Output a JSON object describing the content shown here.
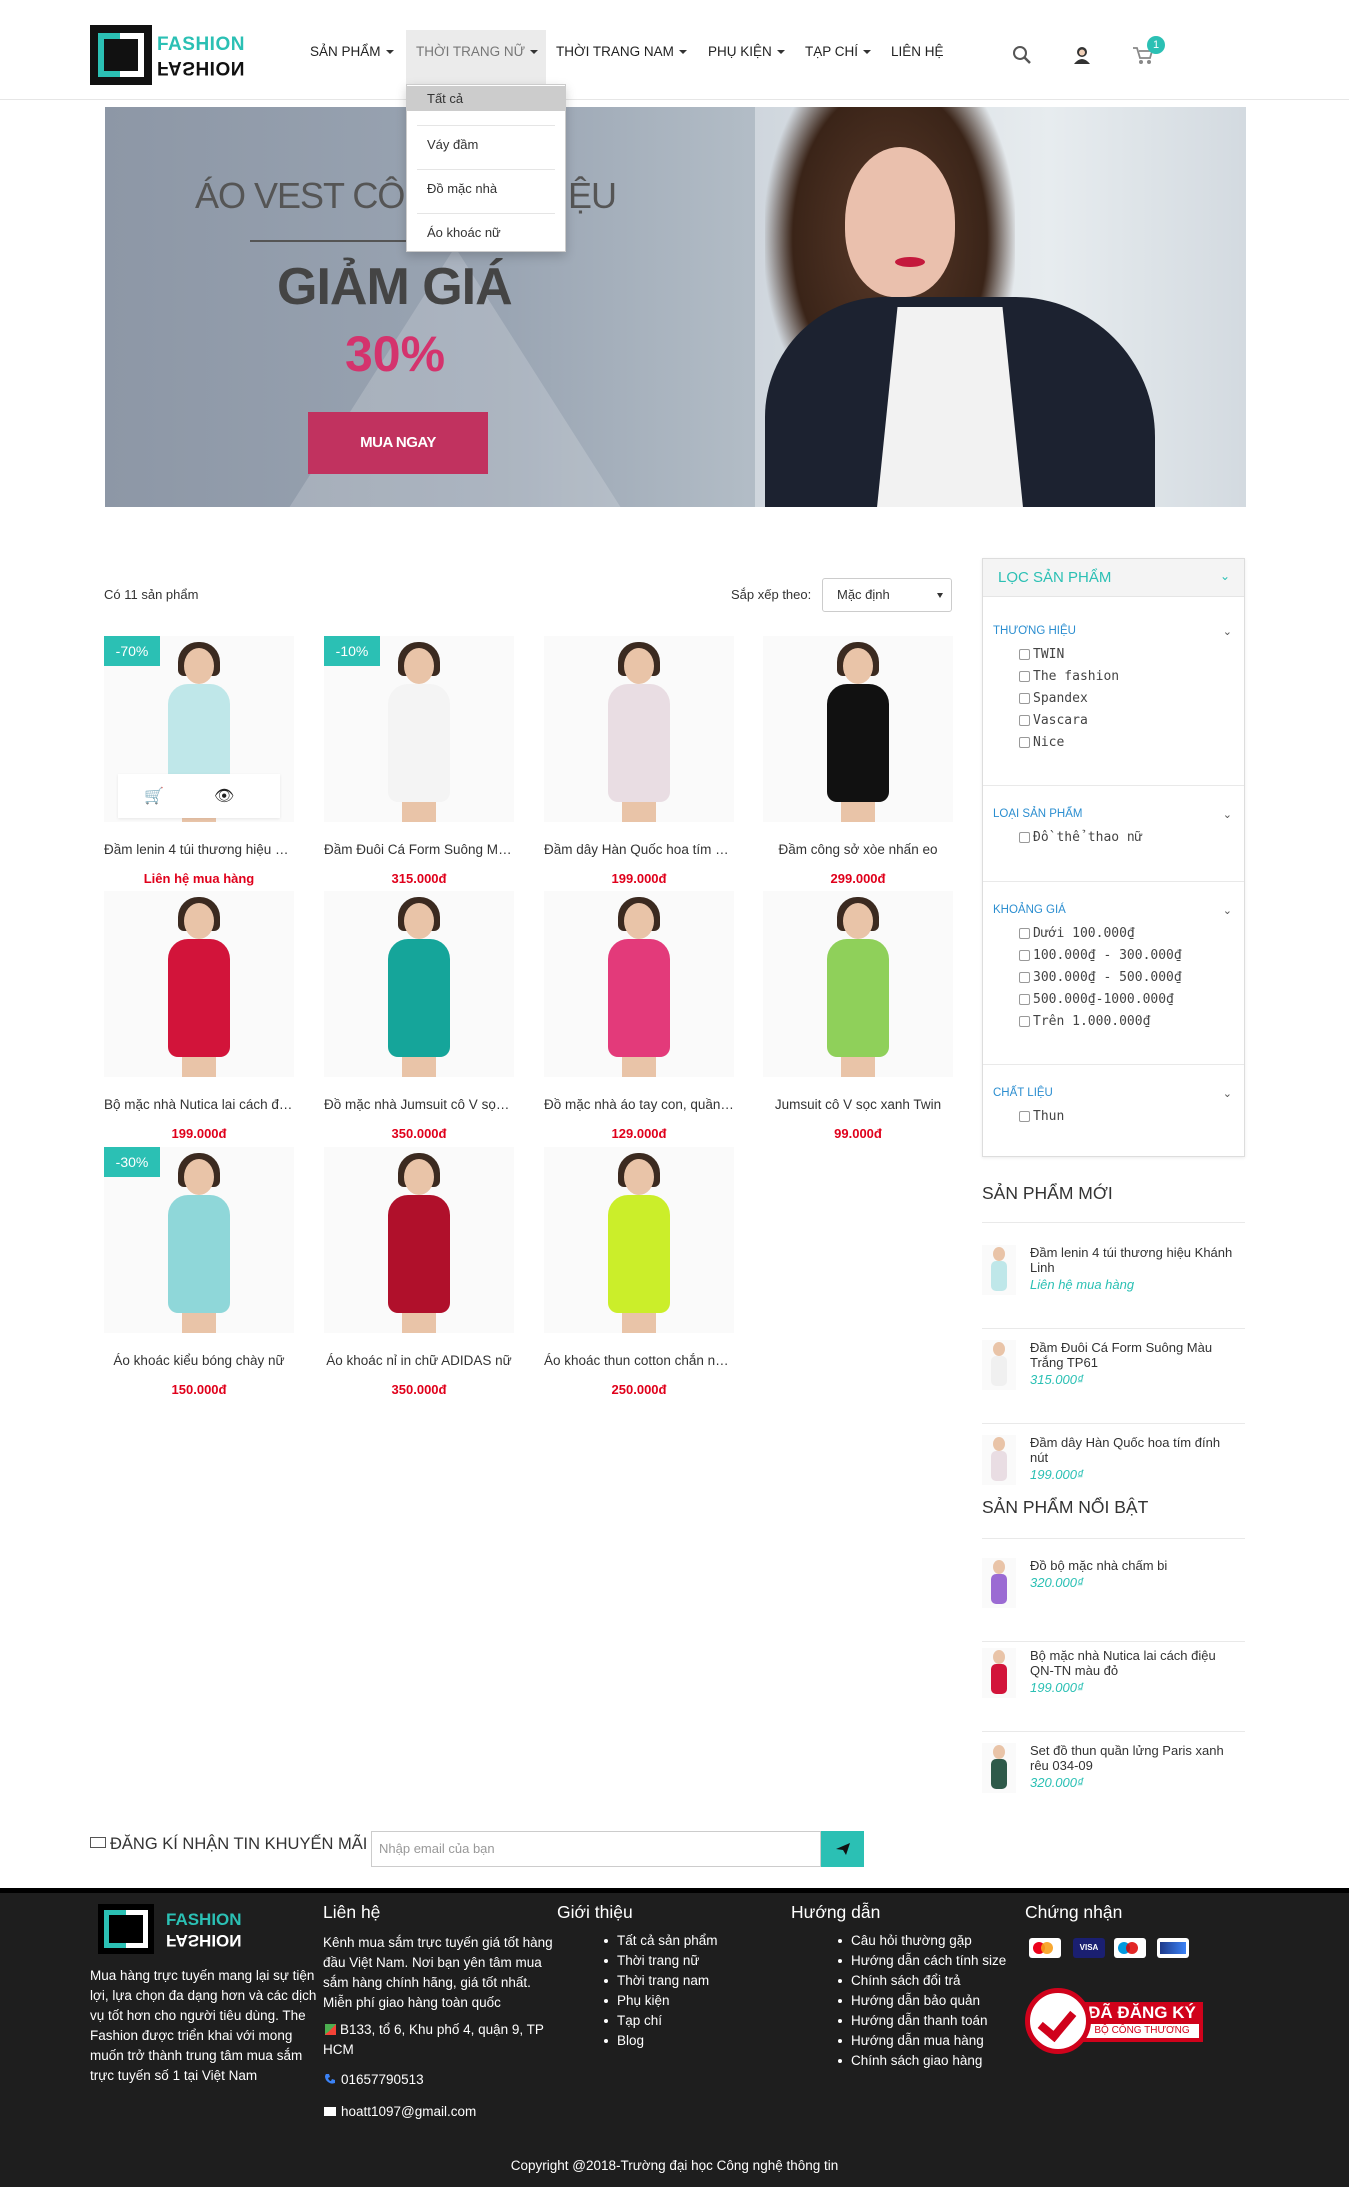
{
  "brand": {
    "line1": "FASHION",
    "line2": "FASHION",
    "accent": "#2bc0b4"
  },
  "nav": {
    "items": [
      "SẢN PHẨM",
      "THỜI TRANG NỮ",
      "THỜI TRANG NAM",
      "PHỤ KIỆN",
      "TẠP CHÍ",
      "LIÊN HỆ"
    ],
    "cart_count": "1",
    "dropdown": [
      "Tất cả",
      "Váy đầm",
      "Đồ mặc nhà",
      "Áo khoác nữ"
    ]
  },
  "banner": {
    "headline": "ÁO VEST CÔNG",
    "headline_end": "ỆU",
    "sale": "GIẢM GIÁ",
    "percent": "30%",
    "cta": "MUA NGAY"
  },
  "toolbar": {
    "count": "Có 11 sản phẩm",
    "sort_label": "Sắp xếp theo:",
    "sort_value": "Mặc định"
  },
  "products": [
    {
      "name": "Đầm lenin 4 túi thương hiệu Khánh Linh",
      "price": "Liên hệ mua hàng",
      "badge": "-70%",
      "color": "#bfe7e9"
    },
    {
      "name": "Đầm Đuôi Cá Form Suông Màu Trắng TP61",
      "price": "315.000đ",
      "badge": "-10%",
      "color": "#f4f4f4"
    },
    {
      "name": "Đầm dây Hàn Quốc hoa tím đính nút",
      "price": "199.000đ",
      "badge": "",
      "color": "#e9dde3"
    },
    {
      "name": "Đầm công sở xòe nhấn eo",
      "price": "299.000đ",
      "badge": "",
      "color": "#111111"
    },
    {
      "name": "Bộ mặc nhà Nutica lai cách điệu QN-TN màu đỏ",
      "price": "199.000đ",
      "badge": "",
      "color": "#d2143a"
    },
    {
      "name": "Đồ mặc nhà Jumsuit cô V sọc xanh",
      "price": "350.000đ",
      "badge": "",
      "color": "#15a59a"
    },
    {
      "name": "Đồ mặc nhà áo tay con, quần short",
      "price": "129.000đ",
      "badge": "",
      "color": "#e33a7a"
    },
    {
      "name": "Jumsuit cô V sọc xanh Twin",
      "price": "99.000đ",
      "badge": "",
      "color": "#8fd05a"
    },
    {
      "name": "Áo khoác kiểu bóng chày nữ",
      "price": "150.000đ",
      "badge": "-30%",
      "color": "#8fd7d9"
    },
    {
      "name": "Áo khoác nỉ in chữ ADIDAS nữ",
      "price": "350.000đ",
      "badge": "",
      "color": "#b0102b"
    },
    {
      "name": "Áo khoác thun cotton chắn nắng",
      "price": "250.000đ",
      "badge": "",
      "color": "#cbee2a"
    }
  ],
  "filter": {
    "title": "LỌC SẢN PHẨM",
    "groups": [
      {
        "title": "THƯƠNG HIỆU",
        "items": [
          "TWIN",
          "The fashion",
          "Spandex",
          "Vascara",
          "Nice"
        ]
      },
      {
        "title": "LOẠI SẢN PHẨM",
        "items": [
          "Đồ thể thao nữ"
        ]
      },
      {
        "title": "KHOẢNG GIÁ",
        "items": [
          "Dưới 100.000₫",
          "100.000₫ - 300.000₫",
          "300.000₫ - 500.000₫",
          "500.000₫-1000.000₫",
          "Trên 1.000.000₫"
        ]
      },
      {
        "title": "CHẤT LIỆU",
        "items": [
          "Thun"
        ]
      }
    ]
  },
  "new_products": {
    "title": "SẢN PHẨM MỚI",
    "items": [
      {
        "name": "Đầm lenin 4 túi thương hiệu Khánh Linh",
        "price": "Liên hệ mua hàng",
        "color": "#bfe7e9"
      },
      {
        "name": "Đầm Đuôi Cá Form Suông Màu Trắng TP61",
        "price": "315.000₫",
        "color": "#f0f0f0"
      },
      {
        "name": "Đầm dây Hàn Quốc hoa tím đính nút",
        "price": "199.000₫",
        "color": "#e9dde3"
      }
    ]
  },
  "featured_products": {
    "title": "SẢN PHẨM NỔI BẬT",
    "items": [
      {
        "name": "Đồ bộ mặc nhà chấm bi",
        "price": "320.000₫",
        "color": "#9b6bd3"
      },
      {
        "name": "Bộ mặc nhà Nutica lai cách điệu QN-TN màu đỏ",
        "price": "199.000₫",
        "color": "#d2143a"
      },
      {
        "name": "Set đồ thun quần lửng Paris xanh rêu 034-09",
        "price": "320.000₫",
        "color": "#2f5a4a"
      }
    ]
  },
  "newsletter": {
    "label": "ĐĂNG KÍ NHẬN TIN KHUYẾN MÃI",
    "placeholder": "Nhập email của bạn"
  },
  "footer": {
    "about": "Mua hàng trực tuyến mang lại sự tiện lợi, lựa chọn đa dạng hơn và các dịch vụ tốt hơn cho người tiêu dùng. The Fashion được triển khai với mong muốn trở thành trung tâm mua sắm trực tuyến số 1 tại Việt Nam",
    "contact": {
      "title": "Liên hệ",
      "text": "Kênh mua sắm trực tuyến giá tốt hàng đầu Việt Nam. Nơi bạn yên tâm mua sắm hàng chính hãng, giá tốt nhất. Miễn phí giao hàng toàn quốc",
      "address": "B133, tổ 6, Khu phố 4, quận 9, TP HCM",
      "phone": "01657790513",
      "email": "hoatt1097@gmail.com"
    },
    "intro": {
      "title": "Giới thiệu",
      "links": [
        "Tất cả sản phẩm",
        "Thời trang nữ",
        "Thời trang nam",
        "Phụ kiện",
        "Tạp chí",
        "Blog"
      ]
    },
    "guide": {
      "title": "Hướng dẫn",
      "links": [
        "Câu hỏi thường gặp",
        "Hướng dẫn cách tính size",
        "Chính sách đổi trả",
        "Hướng dẫn bảo quản",
        "Hướng dẫn thanh toán",
        "Hướng dẫn mua hàng",
        "Chính sách giao hàng"
      ]
    },
    "cert": {
      "title": "Chứng nhận",
      "registered": "ĐÃ ĐĂNG KÝ",
      "ministry": "BỘ CÔNG THƯƠNG"
    },
    "copyright": "Copyright @2018-Trường đại học Công nghệ thông tin"
  }
}
